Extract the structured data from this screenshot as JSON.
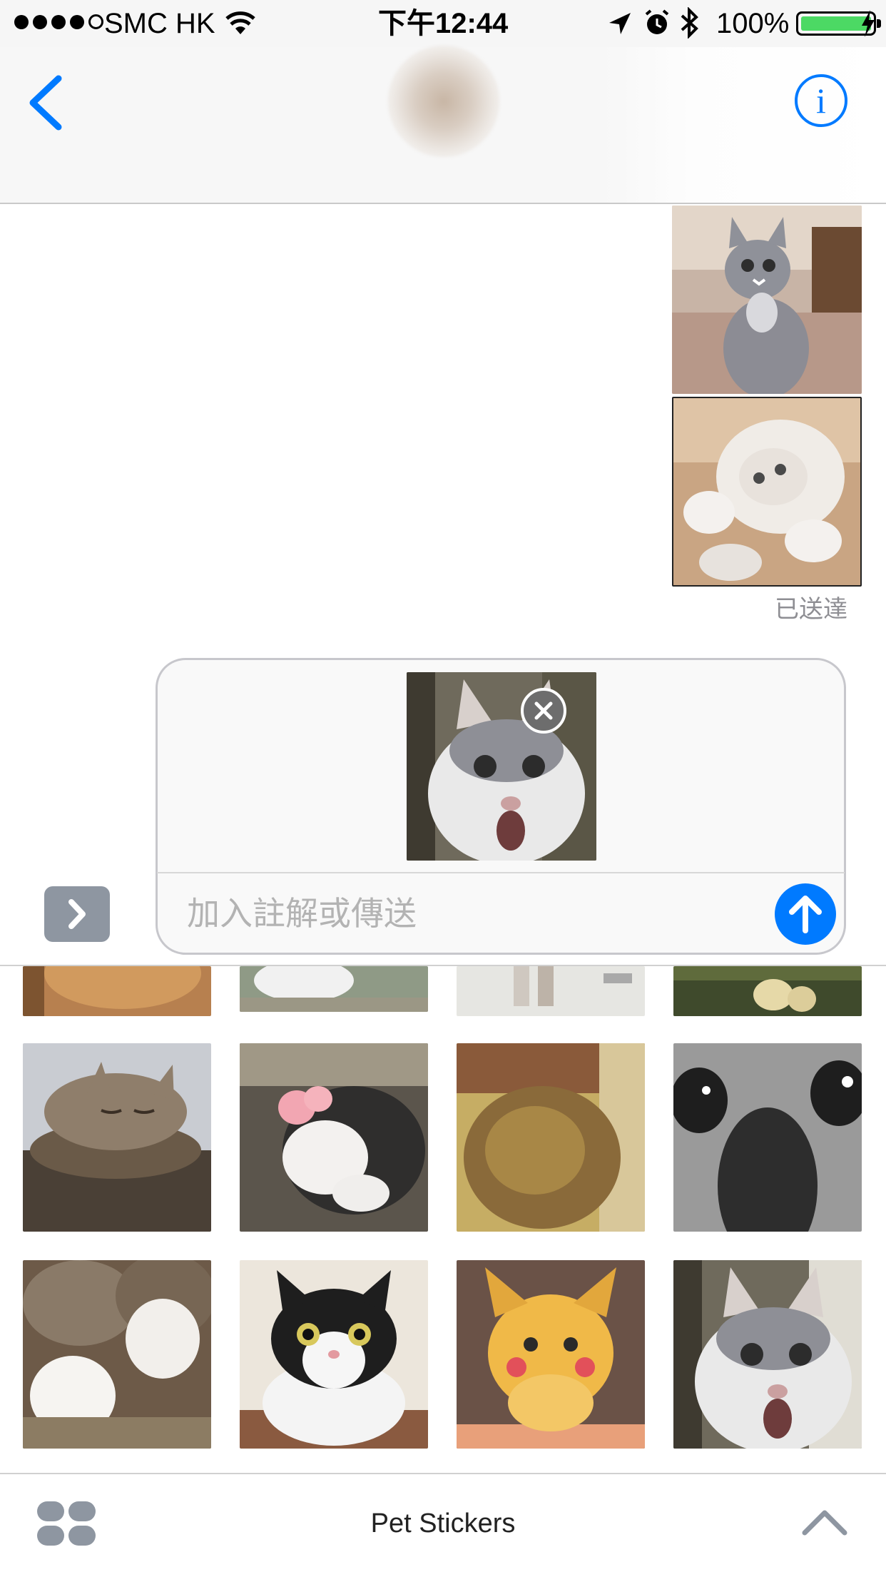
{
  "status_bar": {
    "carrier": "SMC HK",
    "time": "下午12:44",
    "battery_percent": "100%",
    "battery_level": 1.0
  },
  "nav": {
    "back_icon": "chevron-left-icon",
    "info_icon": "info-icon",
    "info_glyph": "i"
  },
  "messages": {
    "sent_stickers": [
      {
        "name": "gray-tabby-kitten-standing"
      },
      {
        "name": "white-cat-upside-down"
      }
    ],
    "status": "已送達"
  },
  "compose": {
    "attached_sticker": "white-gray-cat-surprised",
    "placeholder": "加入註解或傳送",
    "send_icon": "arrow-up-icon",
    "remove_icon": "close-icon",
    "apps_toggle_icon": "chevron-right-icon"
  },
  "drawer": {
    "app_name": "Pet Stickers",
    "apps_icon": "app-grid-icon",
    "expand_icon": "chevron-up-icon",
    "sticker_rows": [
      [
        "orange-cat-partial",
        "white-cat-paws-partial",
        "kitten-legs-partial",
        "cat-feet-on-mat-partial"
      ],
      [
        "tabby-kitten-sleeping",
        "kitten-paws-up",
        "fluffy-kitten-blurry",
        "cat-closeup-eyes"
      ],
      [
        "tabby-paws-on-rope",
        "tuxedo-cat-shocked",
        "orange-kitten-blush",
        "white-gray-cat-surprised"
      ]
    ]
  },
  "colors": {
    "accent": "#007aff",
    "battery_green": "#4cd964",
    "placeholder_gray": "#b3b3b3",
    "icon_gray": "#8e96a1"
  }
}
